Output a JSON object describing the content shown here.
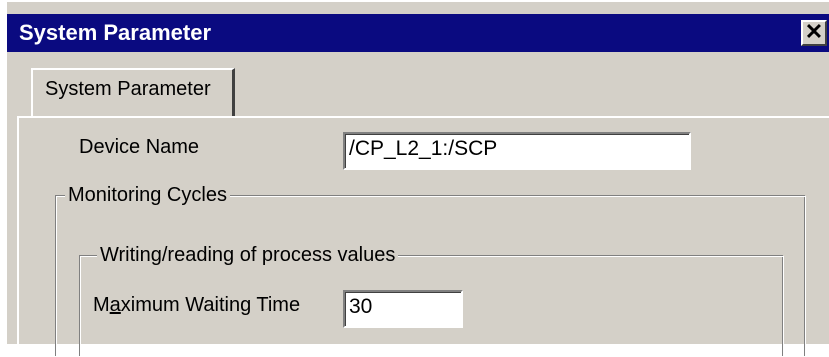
{
  "window": {
    "title": "System Parameter",
    "close_glyph": "✕",
    "close_icon": "close-icon"
  },
  "tabs": [
    {
      "label": "System Parameter",
      "selected": true
    }
  ],
  "device_name": {
    "label": "Device Name",
    "value": "/CP_L2_1:/SCP"
  },
  "monitoring_group": {
    "caption": "Monitoring Cycles"
  },
  "process_group": {
    "caption": "Writing/reading of process values"
  },
  "max_wait": {
    "label_pre": "M",
    "label_accel": "a",
    "label_post": "ximum Waiting Time",
    "value": "30"
  },
  "colors": {
    "titlebar": "#0a0a80",
    "face": "#d4d0c8",
    "field": "#ffffff"
  }
}
